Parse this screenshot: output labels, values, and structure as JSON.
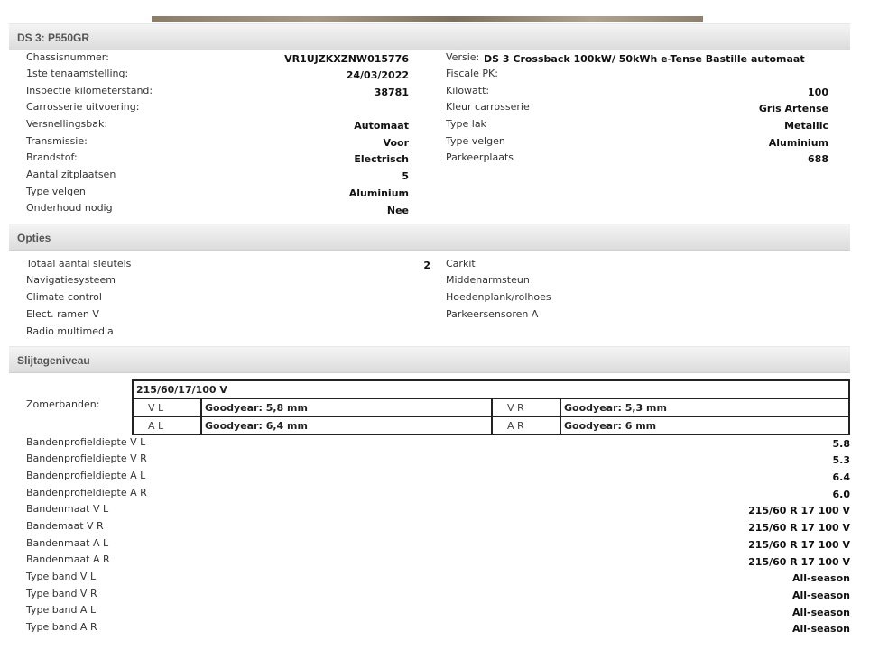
{
  "vehicle": {
    "header": "DS 3: P550GR",
    "left": [
      {
        "label": "Chassisnummer:",
        "value": "VR1UJZKXZNW015776"
      },
      {
        "label": "1ste tenaamstelling:",
        "value": "24/03/2022"
      },
      {
        "label": "Inspectie kilometerstand:",
        "value": "38781"
      },
      {
        "label": "Carrosserie uitvoering:",
        "value": ""
      },
      {
        "label": "Versnellingsbak:",
        "value": "Automaat"
      },
      {
        "label": "Transmissie:",
        "value": "Voor"
      },
      {
        "label": "Brandstof:",
        "value": "Electrisch"
      },
      {
        "label": "Aantal zitplaatsen",
        "value": "5"
      },
      {
        "label": "Type velgen",
        "value": "Aluminium"
      },
      {
        "label": "Onderhoud nodig",
        "value": "Nee"
      }
    ],
    "versie_label": "Versie:",
    "versie_value": "DS 3 Crossback 100kW/ 50kWh e-Tense Bastille automaat",
    "right": [
      {
        "label": "Fiscale PK:",
        "value": ""
      },
      {
        "label": "Kilowatt:",
        "value": "100"
      },
      {
        "label": "Kleur carrosserie",
        "value": "Gris Artense"
      },
      {
        "label": "Type lak",
        "value": "Metallic"
      },
      {
        "label": "Type velgen",
        "value": "Aluminium"
      },
      {
        "label": "Parkeerplaats",
        "value": "688"
      }
    ]
  },
  "options": {
    "header": "Opties",
    "left": [
      {
        "label": "Totaal aantal sleutels",
        "value": "2"
      },
      {
        "label": "Navigatiesysteem",
        "value": ""
      },
      {
        "label": "Climate control",
        "value": ""
      },
      {
        "label": "Elect. ramen V",
        "value": ""
      },
      {
        "label": "Radio multimedia",
        "value": ""
      }
    ],
    "right": [
      "Carkit",
      "Middenarmsteun",
      "Hoedenplank/rolhoes",
      "Parkeersensoren A"
    ]
  },
  "wear": {
    "header": "Slijtageniveau",
    "tyre_size": "215/60/17/100 V",
    "summer_label": "Zomerbanden:",
    "vl_pos": "V L",
    "vl_val": "Goodyear: 5,8 mm",
    "vr_pos": "V R",
    "vr_val": "Goodyear: 5,3 mm",
    "al_pos": "A L",
    "al_val": "Goodyear: 6,4 mm",
    "ar_pos": "A R",
    "ar_val": "Goodyear: 6 mm",
    "rows": [
      {
        "label": "Bandenprofieldiepte V L",
        "value": "5.8"
      },
      {
        "label": "Bandenprofieldiepte V R",
        "value": "5.3"
      },
      {
        "label": "Bandenprofieldiepte A L",
        "value": "6.4"
      },
      {
        "label": "Bandenprofieldiepte A R",
        "value": "6.0"
      },
      {
        "label": "Bandenmaat V L",
        "value": "215/60 R 17 100 V"
      },
      {
        "label": "Bandemaat V R",
        "value": "215/60 R 17 100 V"
      },
      {
        "label": "Bandenmaat A L",
        "value": "215/60 R 17 100 V"
      },
      {
        "label": "Bandenmaat A R",
        "value": "215/60 R 17 100 V"
      },
      {
        "label": "Type band V L",
        "value": "All-season"
      },
      {
        "label": "Type band V R",
        "value": "All-season"
      },
      {
        "label": "Type band A L",
        "value": "All-season"
      },
      {
        "label": "Type band A R",
        "value": "All-season"
      }
    ]
  }
}
